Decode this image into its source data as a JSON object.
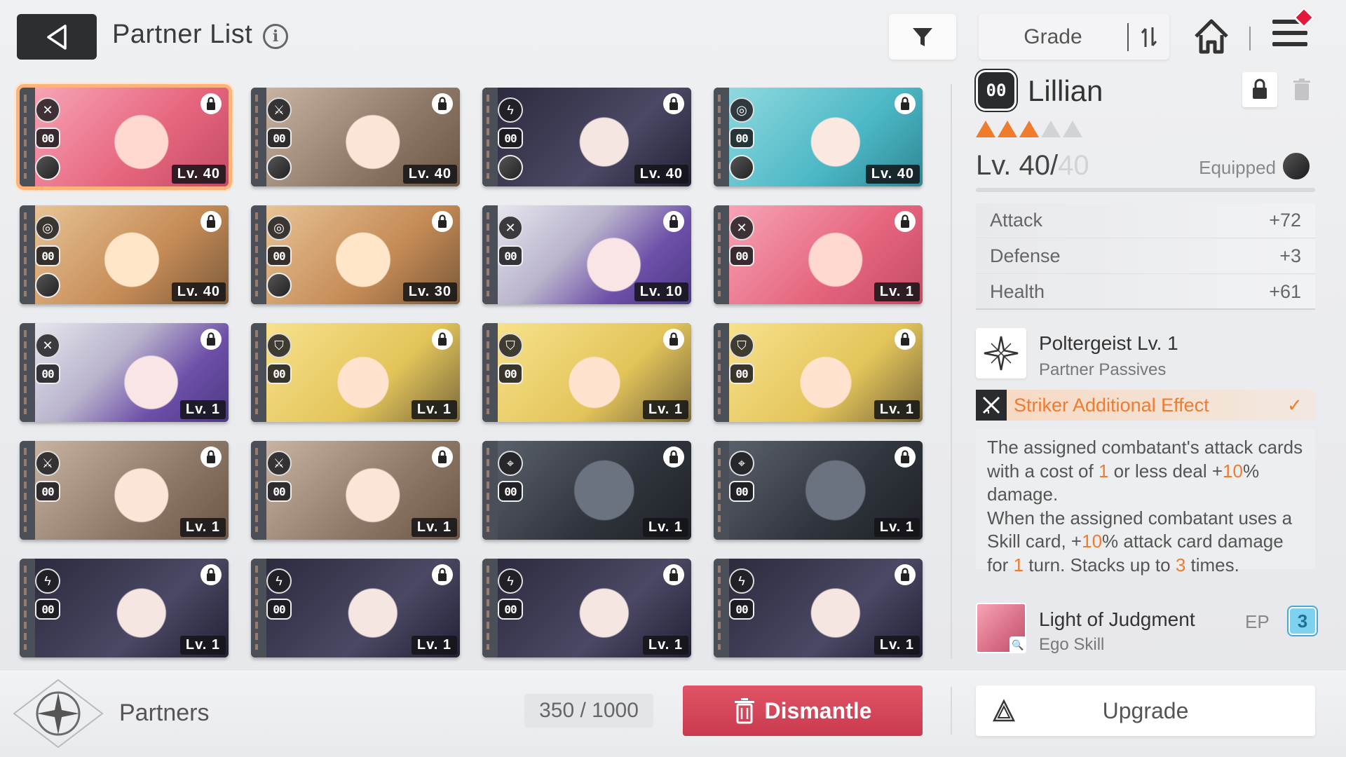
{
  "header": {
    "title": "Partner List",
    "info_icon": "i",
    "sort_label": "Grade"
  },
  "cards": [
    {
      "art": "pink",
      "role": "striker",
      "rarity": "00",
      "level": "Lv. 40",
      "equipped": true,
      "selected": true
    },
    {
      "art": "brown",
      "role": "vanguard",
      "rarity": "00",
      "level": "Lv. 40",
      "equipped": true
    },
    {
      "art": "dark",
      "role": "controller",
      "rarity": "00",
      "level": "Lv. 40",
      "equipped": true
    },
    {
      "art": "teal",
      "role": "hunter",
      "rarity": "00",
      "level": "Lv. 40",
      "equipped": true
    },
    {
      "art": "tan",
      "role": "hunter",
      "rarity": "00",
      "level": "Lv. 40",
      "equipped": true
    },
    {
      "art": "tan",
      "role": "hunter",
      "rarity": "00",
      "level": "Lv. 30",
      "equipped": true
    },
    {
      "art": "purple",
      "role": "striker",
      "rarity": "00",
      "level": "Lv. 10",
      "equipped": false
    },
    {
      "art": "pink",
      "role": "striker",
      "rarity": "00",
      "level": "Lv. 1",
      "equipped": false
    },
    {
      "art": "purple",
      "role": "striker",
      "rarity": "00",
      "level": "Lv. 1",
      "equipped": false
    },
    {
      "art": "blond",
      "role": "ranger",
      "rarity": "00",
      "level": "Lv. 1",
      "equipped": false
    },
    {
      "art": "blond",
      "role": "ranger",
      "rarity": "00",
      "level": "Lv. 1",
      "equipped": false
    },
    {
      "art": "blond",
      "role": "ranger",
      "rarity": "00",
      "level": "Lv. 1",
      "equipped": false
    },
    {
      "art": "brown",
      "role": "vanguard",
      "rarity": "00",
      "level": "Lv. 1",
      "equipped": false
    },
    {
      "art": "brown",
      "role": "vanguard",
      "rarity": "00",
      "level": "Lv. 1",
      "equipped": false
    },
    {
      "art": "mech",
      "role": "psionic",
      "rarity": "00",
      "level": "Lv. 1",
      "equipped": false
    },
    {
      "art": "mech",
      "role": "psionic",
      "rarity": "00",
      "level": "Lv. 1",
      "equipped": false
    },
    {
      "art": "dark",
      "role": "controller",
      "rarity": "00",
      "level": "Lv. 1",
      "equipped": false
    },
    {
      "art": "dark",
      "role": "controller",
      "rarity": "00",
      "level": "Lv. 1",
      "equipped": false
    },
    {
      "art": "dark",
      "role": "controller",
      "rarity": "00",
      "level": "Lv. 1",
      "equipped": false
    },
    {
      "art": "dark",
      "role": "controller",
      "rarity": "00",
      "level": "Lv. 1",
      "equipped": false
    }
  ],
  "detail": {
    "rarity_badge": "00",
    "name": "Lillian",
    "stars_filled": 3,
    "stars_total": 5,
    "level_current": "Lv. 40/",
    "level_max": "40",
    "equipped_label": "Equipped",
    "stats": [
      {
        "label": "Attack",
        "value": "+72"
      },
      {
        "label": "Defense",
        "value": "+3"
      },
      {
        "label": "Health",
        "value": "+61"
      }
    ],
    "passive": {
      "title": "Poltergeist Lv. 1",
      "subtitle": "Partner Passives"
    },
    "effect": {
      "title": "Striker Additional Effect",
      "check": "✓",
      "text_parts": [
        {
          "t": "The assigned combatant's attack cards with a cost of "
        },
        {
          "t": "1",
          "hl": true
        },
        {
          "t": " or less deal +"
        },
        {
          "t": "10",
          "hl": true
        },
        {
          "t": "% damage."
        },
        {
          "br": true
        },
        {
          "t": "When the assigned combatant uses a Skill card, +"
        },
        {
          "t": "10",
          "hl": true
        },
        {
          "t": "% attack card damage for "
        },
        {
          "t": "1",
          "hl": true
        },
        {
          "t": " turn. Stacks up to "
        },
        {
          "t": "3",
          "hl": true
        },
        {
          "t": " times."
        }
      ]
    },
    "ego": {
      "title": "Light of Judgment",
      "subtitle": "Ego Skill",
      "ep_label": "EP",
      "ep_value": "3"
    }
  },
  "footer": {
    "label": "Partners",
    "count": "350 / 1000",
    "dismantle_label": "Dismantle",
    "upgrade_label": "Upgrade"
  },
  "colors": {
    "accent": "#f07b2d",
    "dismantle": "#d2445a",
    "ep": "#7ed1ef"
  }
}
